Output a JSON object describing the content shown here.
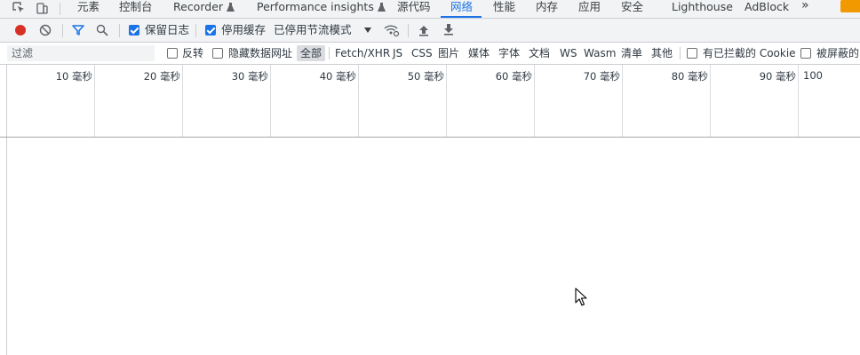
{
  "tabs": [
    {
      "label": "元素"
    },
    {
      "label": "控制台"
    },
    {
      "label": "Recorder"
    },
    {
      "label": "Performance insights"
    },
    {
      "label": "源代码"
    },
    {
      "label": "网络",
      "selected": true
    },
    {
      "label": "性能"
    },
    {
      "label": "内存"
    },
    {
      "label": "应用"
    },
    {
      "label": "安全"
    },
    {
      "label": "Lighthouse"
    },
    {
      "label": "AdBlock"
    }
  ],
  "more_tabs": "»",
  "toolbar": {
    "preserve_log": {
      "label": "保留日志",
      "checked": true
    },
    "disable_cache": {
      "label": "停用缓存",
      "checked": true
    },
    "throttling": {
      "value": "已停用节流模式"
    }
  },
  "filter": {
    "placeholder": "过滤",
    "invert": {
      "label": "反转",
      "checked": false
    },
    "hide_data_urls": {
      "label": "隐藏数据网址",
      "checked": false
    },
    "types": [
      "全部",
      "Fetch/XHR",
      "JS",
      "CSS",
      "图片",
      "媒体",
      "字体",
      "文档",
      "WS",
      "Wasm",
      "清单",
      "其他"
    ],
    "active_type": "全部",
    "blocked_cookies": {
      "label": "有已拦截的 Cookie",
      "checked": false
    },
    "blocked_requests": {
      "label": "被屏蔽的",
      "checked": false
    }
  },
  "timeline": {
    "ticks": [
      "10 毫秒",
      "20 毫秒",
      "30 毫秒",
      "40 毫秒",
      "50 毫秒",
      "60 毫秒",
      "70 毫秒",
      "80 毫秒",
      "90 毫秒",
      "100"
    ]
  },
  "colors": {
    "accent": "#1a73e8",
    "record": "#d93025",
    "toolbar_bg": "#f1f3f4",
    "warning": "#f29900"
  }
}
